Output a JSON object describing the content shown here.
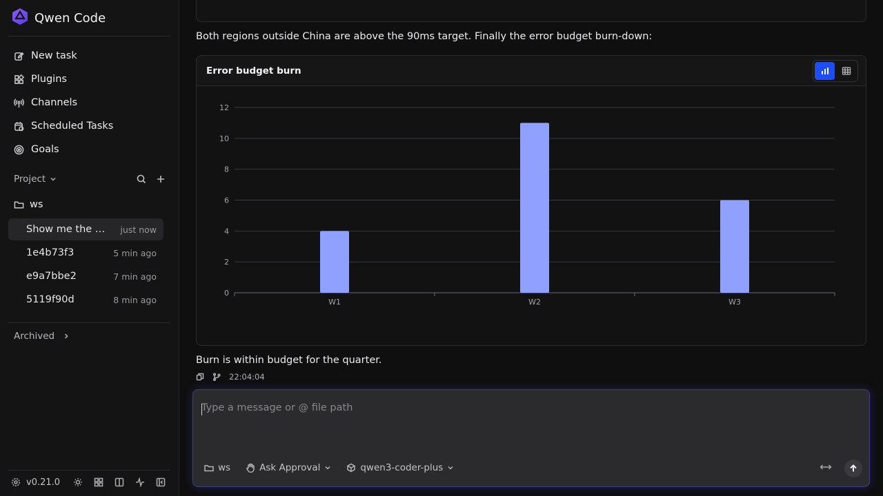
{
  "app": {
    "title": "Qwen Code",
    "version": "v0.21.0"
  },
  "sidebar": {
    "nav": [
      {
        "label": "New task",
        "icon": "edit-icon"
      },
      {
        "label": "Plugins",
        "icon": "plugins-icon"
      },
      {
        "label": "Channels",
        "icon": "broadcast-icon"
      },
      {
        "label": "Scheduled Tasks",
        "icon": "calendar-clock-icon"
      },
      {
        "label": "Goals",
        "icon": "target-icon"
      }
    ],
    "project_label": "Project",
    "folder": "ws",
    "sessions": [
      {
        "title": "Show me the …",
        "time": "just now",
        "active": true
      },
      {
        "title": "1e4b73f3",
        "time": "5 min ago",
        "active": false
      },
      {
        "title": "e9a7bbe2",
        "time": "7 min ago",
        "active": false
      },
      {
        "title": "5119f90d",
        "time": "8 min ago",
        "active": false
      }
    ],
    "archived_label": "Archived"
  },
  "conversation": {
    "intro": "Both regions outside China are above the 90ms target. Finally the error budget burn-down:",
    "outro": "Burn is within budget for the quarter.",
    "timestamp": "22:04:04"
  },
  "chart_data": {
    "type": "bar",
    "title": "Error budget burn",
    "categories": [
      "W1",
      "W2",
      "W3"
    ],
    "values": [
      4,
      11,
      6
    ],
    "ylim": [
      0,
      12
    ],
    "yticks": [
      0,
      2,
      4,
      6,
      8,
      10,
      12
    ],
    "grid": true,
    "bar_color": "#8fa0ff",
    "xlabel": "",
    "ylabel": ""
  },
  "composer": {
    "placeholder": "Type a message or @ file path",
    "folder": "ws",
    "approval": "Ask Approval",
    "model": "qwen3-coder-plus"
  },
  "colors": {
    "accent": "#1d4ef5",
    "bar": "#8fa0ff",
    "brand": "#6b4cf5"
  }
}
